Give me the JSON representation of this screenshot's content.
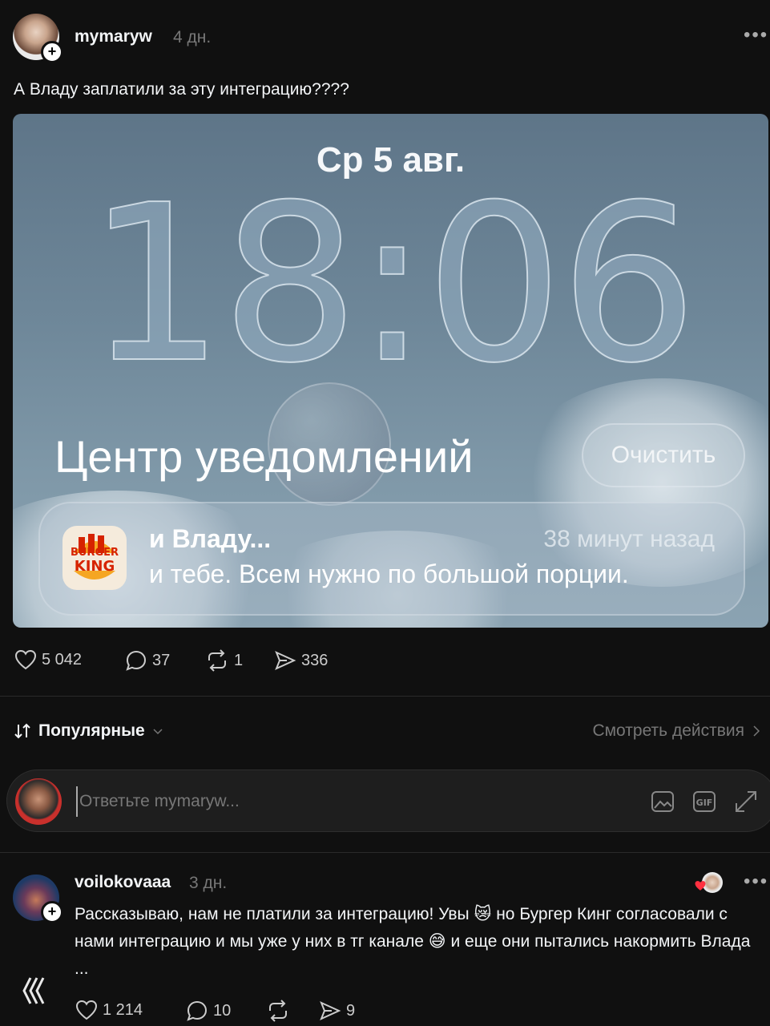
{
  "post": {
    "username": "mymaryw",
    "time": "4 дн.",
    "text": "А Владу заплатили за эту интеграцию????",
    "more_icon": "more-dots-icon",
    "media": {
      "date": "Ср 5 авг.",
      "clock": "18:06",
      "center_title": "Центр уведомлений",
      "clear_button": "Очистить",
      "notification": {
        "app_logo_text": [
          "BURGER",
          "KING"
        ],
        "title": "и Владу...",
        "time": "38 минут назад",
        "body": "и тебе. Всем нужно по большой порции."
      }
    },
    "stats": {
      "likes": "5 042",
      "comments": "37",
      "reposts": "1",
      "shares": "336"
    }
  },
  "sort": {
    "label": "Популярные",
    "view_activity": "Смотреть действия"
  },
  "reply": {
    "placeholder": "Ответьте mymaryw...",
    "icons": [
      "image-icon",
      "gif-icon",
      "expand-icon"
    ]
  },
  "comment": {
    "username": "voilokovaaa",
    "time": "3 дн.",
    "text_parts": [
      "Рассказываю, нам не платили за интеграцию! Увы ",
      " но Бургер Кинг согласовали с нами интеграцию и мы уже у них в тг канале ",
      " и еще они пытались накормить Влада ..."
    ],
    "emoji": [
      "😿",
      "😅"
    ],
    "stats": {
      "likes": "1 214",
      "comments": "10",
      "shares": "9"
    }
  },
  "colors": {
    "background": "#101010",
    "text": "#f3f5f7",
    "muted": "#777777"
  }
}
